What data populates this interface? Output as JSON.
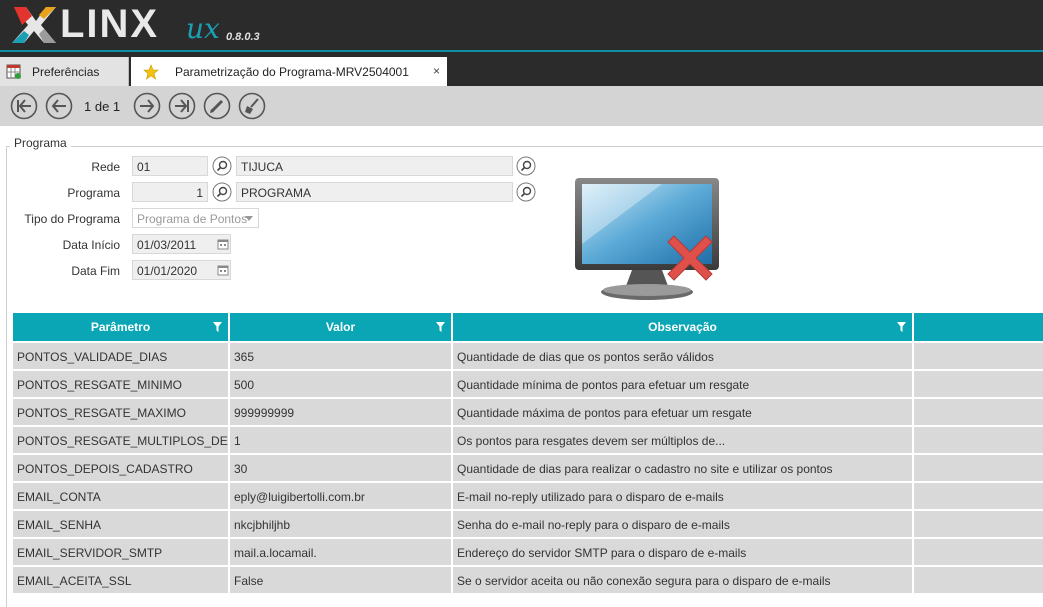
{
  "app": {
    "logo_text": "LINX",
    "logo_suffix": "ux",
    "version": "0.8.0.3"
  },
  "tabs": [
    {
      "label": "Preferências",
      "icon": "grid-settings-icon"
    },
    {
      "label": "Parametrização do Programa-MRV2504001",
      "icon": "star-icon",
      "close": "×"
    }
  ],
  "toolbar": {
    "pager_text": "1 de 1"
  },
  "form": {
    "legend": "Programa",
    "rede_label": "Rede",
    "rede_code": "01",
    "rede_name": "TIJUCA",
    "programa_label": "Programa",
    "programa_code": "1",
    "programa_name": "PROGRAMA",
    "tipo_label": "Tipo do Programa",
    "tipo_value": "Programa de Pontos",
    "inicio_label": "Data Início",
    "inicio_value": "01/03/2011",
    "fim_label": "Data Fim",
    "fim_value": "01/01/2020"
  },
  "grid": {
    "columns": [
      "Parâmetro",
      "Valor",
      "Observação"
    ],
    "rows": [
      {
        "param": "PONTOS_VALIDADE_DIAS",
        "valor": "365",
        "obs": "Quantidade de dias que os pontos serão válidos"
      },
      {
        "param": "PONTOS_RESGATE_MINIMO",
        "valor": "500",
        "obs": "Quantidade mínima de pontos para efetuar um resgate"
      },
      {
        "param": "PONTOS_RESGATE_MAXIMO",
        "valor": "999999999",
        "obs": "Quantidade máxima de pontos para efetuar um resgate"
      },
      {
        "param": "PONTOS_RESGATE_MULTIPLOS_DE",
        "valor": "1",
        "obs": "Os pontos para resgates devem ser múltiplos de..."
      },
      {
        "param": "PONTOS_DEPOIS_CADASTRO",
        "valor": "30",
        "obs": "Quantidade de dias para realizar o cadastro no site e utilizar os pontos"
      },
      {
        "param": "EMAIL_CONTA",
        "valor": "eply@luigibertolli.com.br",
        "obs": "E-mail no-reply utilizado para o disparo de e-mails"
      },
      {
        "param": "EMAIL_SENHA",
        "valor": "nkcjbhiljhb",
        "obs": "Senha do e-mail no-reply para o disparo de e-mails"
      },
      {
        "param": "EMAIL_SERVIDOR_SMTP",
        "valor": "mail.a.locamail.",
        "obs": "Endereço do servidor SMTP para o disparo de e-mails"
      },
      {
        "param": "EMAIL_ACEITA_SSL",
        "valor": "False",
        "obs": "Se o servidor aceita ou não conexão segura para o disparo de e-mails"
      }
    ]
  },
  "colors": {
    "accent": "#0aa6b6",
    "header_bg": "#2b2b2b",
    "toolbar_bg": "#d4d4d4",
    "row_bg": "#d9d9d9"
  }
}
